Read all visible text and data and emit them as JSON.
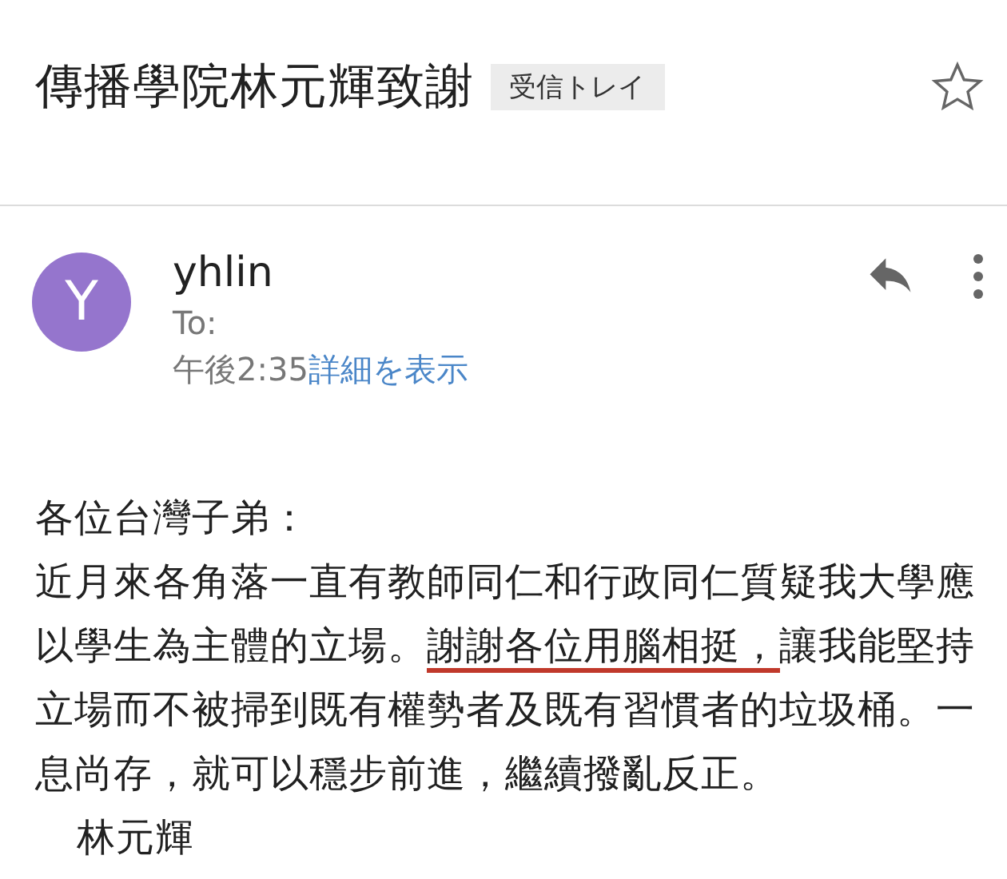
{
  "subject": "傳播學院林元輝致謝",
  "label": "受信トレイ",
  "starred": false,
  "message": {
    "avatar_initial": "Y",
    "sender": "yhlin",
    "to": "To:",
    "time": "午後2:35",
    "details_link": "詳細を表示"
  },
  "body": {
    "greeting": "各位台灣子弟：",
    "paragraph": [
      {
        "text": "近月來各角落一直有教師同仁和行政同仁質疑我大學應以學生為主體的立場。",
        "underlined": false
      },
      {
        "text": "謝謝各位用腦相挺，",
        "underlined": true
      },
      {
        "text": "讓我能堅持立場而不被掃到既有權勢者及既有習慣者的垃圾桶。一息尚存，就可以穩步前進，繼續撥亂反正。",
        "underlined": false
      }
    ],
    "signature": "林元輝"
  }
}
